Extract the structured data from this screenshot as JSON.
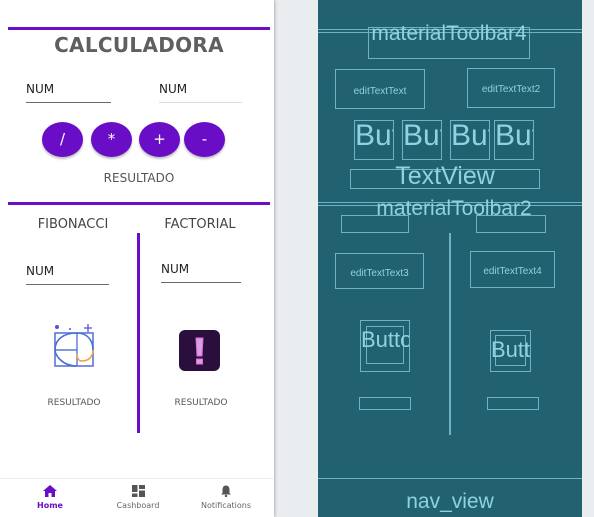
{
  "app": {
    "title": "CALCULADORA",
    "num_placeholder_1": "NUM",
    "num_placeholder_2": "NUM",
    "operators": [
      "/",
      "*",
      "+",
      "-"
    ],
    "result_label": "RESULTADO",
    "fibonacci_title": "FIBONACCI",
    "factorial_title": "FACTORIAL",
    "fib_num_placeholder": "NUM",
    "fact_num_placeholder": "NUM",
    "fib_result": "RESULTADO",
    "fact_result": "RESULTADO",
    "nav": {
      "items": [
        {
          "label": "Home",
          "icon": "home-icon",
          "active": true
        },
        {
          "label": "Cashboard",
          "icon": "dashboard-icon",
          "active": false
        },
        {
          "label": "Notifications",
          "icon": "bell-icon",
          "active": false
        }
      ]
    }
  },
  "blueprint": {
    "toolbar_top": "materialToolbar4",
    "edit_text_1": "editTextText",
    "edit_text_2": "editTextText2",
    "button_text": "Button",
    "text_view": "TextView",
    "toolbar_mid": "materialToolbar2",
    "edit_text_3": "editTextText3",
    "edit_text_4": "editTextText4",
    "button_left": "Button",
    "button_right": "Button",
    "nav_view": "nav_view"
  },
  "colors": {
    "accent": "#6a0dc6",
    "blueprint_bg": "#22616f",
    "blueprint_line": "#6fb3c2"
  }
}
